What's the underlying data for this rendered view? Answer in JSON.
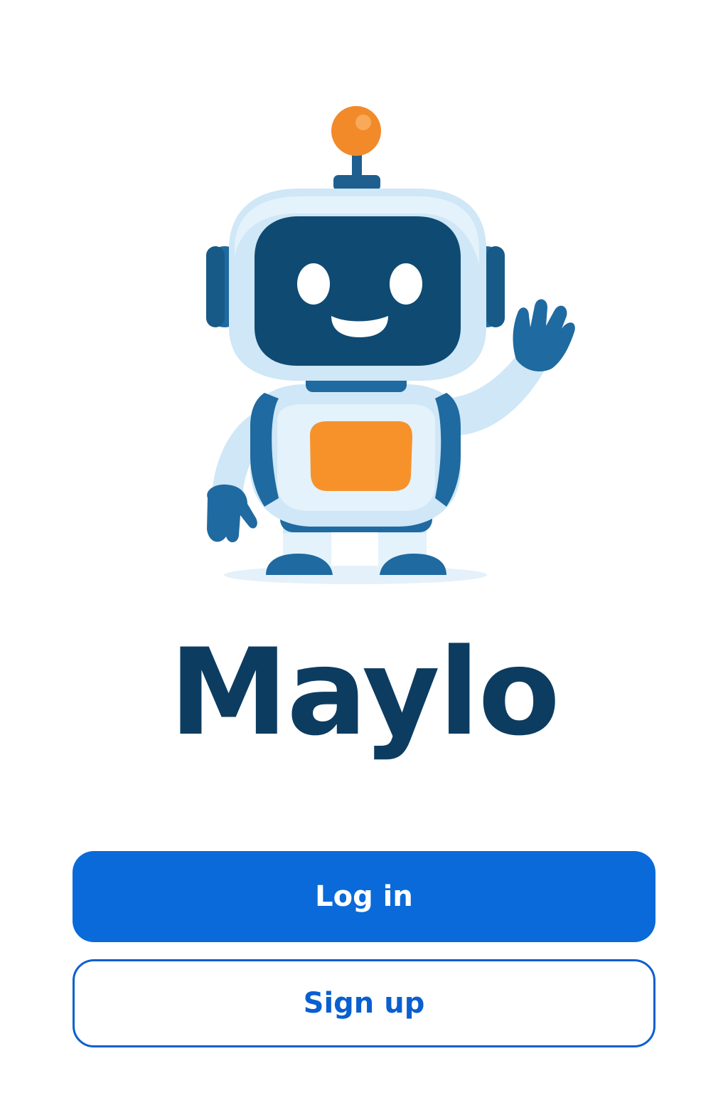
{
  "app": {
    "name": "Maylo"
  },
  "mascot": {
    "icon": "waving-robot-mascot",
    "colors": {
      "dark_blue": "#0f4a73",
      "mid_blue": "#1f6aa0",
      "light_blue": "#cfe7f6",
      "pale_blue": "#e4f2fb",
      "orange": "#f7922b"
    }
  },
  "actions": {
    "login_label": "Log in",
    "signup_label": "Sign up"
  },
  "colors": {
    "primary": "#0a6ad9",
    "title": "#0d3c61",
    "background": "#ffffff"
  }
}
